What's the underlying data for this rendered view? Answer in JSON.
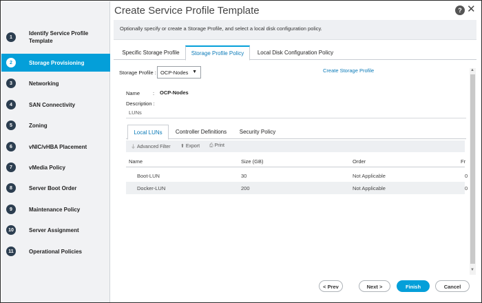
{
  "window": {
    "title": "Create Service Profile Template",
    "help": "?",
    "close": "✕"
  },
  "subtitle": "Optionally specify or create a Storage Profile, and select a local disk configuration policy.",
  "steps": [
    {
      "num": "1",
      "label": "Identify Service Profile Template"
    },
    {
      "num": "2",
      "label": "Storage Provisioning"
    },
    {
      "num": "3",
      "label": "Networking"
    },
    {
      "num": "4",
      "label": "SAN Connectivity"
    },
    {
      "num": "5",
      "label": "Zoning"
    },
    {
      "num": "6",
      "label": "vNIC/vHBA Placement"
    },
    {
      "num": "7",
      "label": "vMedia Policy"
    },
    {
      "num": "8",
      "label": "Server Boot Order"
    },
    {
      "num": "9",
      "label": "Maintenance Policy"
    },
    {
      "num": "10",
      "label": "Server Assignment"
    },
    {
      "num": "11",
      "label": "Operational Policies"
    }
  ],
  "tabs": [
    "Specific Storage Profile",
    "Storage Profile Policy",
    "Local Disk Configuration Policy"
  ],
  "form": {
    "storage_profile_label": "Storage Profile :",
    "storage_profile_value": "OCP-Nodes",
    "create_link": "Create Storage Profile",
    "name_label": "Name",
    "colon": ":",
    "name_value": "OCP-Nodes",
    "description_label": "Description :",
    "luns_label": "LUNs"
  },
  "inner_tabs": [
    "Local LUNs",
    "Controller Definitions",
    "Security Policy"
  ],
  "toolbar": {
    "filter": "Advanced Filter",
    "export": "Export",
    "print": "Print"
  },
  "table": {
    "headers": [
      "Name",
      "Size (GB)",
      "Order",
      "Fr"
    ],
    "rows": [
      {
        "name": "Boot-LUN",
        "size": "30",
        "order": "Not Applicable",
        "fr": "0"
      },
      {
        "name": "Docker-LUN",
        "size": "200",
        "order": "Not Applicable",
        "fr": "0"
      }
    ]
  },
  "buttons": {
    "prev": "< Prev",
    "next": "Next >",
    "finish": "Finish",
    "cancel": "Cancel"
  },
  "colors": {
    "accent": "#049fd9",
    "link": "#0a7ab8",
    "sidebar_bg": "#f1f2f4"
  }
}
